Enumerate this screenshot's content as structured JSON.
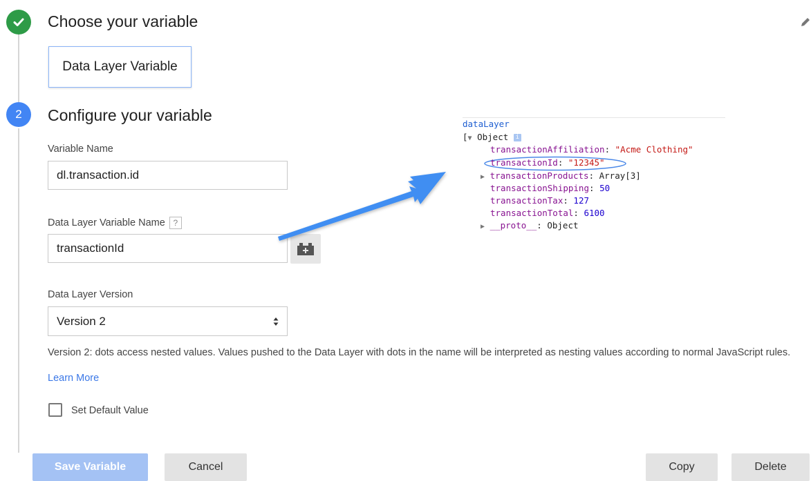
{
  "step1": {
    "title": "Choose your variable",
    "variable_type": "Data Layer Variable"
  },
  "step2": {
    "number": "2",
    "title": "Configure your variable"
  },
  "fields": {
    "variable_name": {
      "label": "Variable Name",
      "value": "dl.transaction.id"
    },
    "dl_variable_name": {
      "label": "Data Layer Variable Name",
      "help": "?",
      "value": "transactionId"
    },
    "dl_version": {
      "label": "Data Layer Version",
      "selected": "Version 2",
      "description": "Version 2: dots access nested values. Values pushed to the Data Layer with dots in the name will be interpreted as nesting values according to normal JavaScript rules.",
      "learn_more": "Learn More"
    },
    "default_value": {
      "label": "Set Default Value",
      "checked": false
    }
  },
  "buttons": {
    "save": "Save Variable",
    "cancel": "Cancel",
    "copy": "Copy",
    "delete": "Delete"
  },
  "console": {
    "title": "dataLayer",
    "object_label": "Object",
    "info": "i",
    "props": [
      {
        "key": "transactionAffiliation",
        "value": "\"Acme Clothing\"",
        "kind": "str"
      },
      {
        "key": "transactionId",
        "value": "\"12345\"",
        "kind": "str",
        "highlighted": true
      },
      {
        "key": "transactionProducts",
        "value": "Array[3]",
        "kind": "plain",
        "expandable": true
      },
      {
        "key": "transactionShipping",
        "value": "50",
        "kind": "num"
      },
      {
        "key": "transactionTax",
        "value": "127",
        "kind": "num"
      },
      {
        "key": "transactionTotal",
        "value": "6100",
        "kind": "num"
      },
      {
        "key": "__proto__",
        "value": "Object",
        "kind": "plain",
        "expandable": true
      }
    ]
  },
  "colors": {
    "success": "#2e9b47",
    "step_blue": "#4285f4",
    "arrow": "#3f8ef2",
    "link": "#3b78e7"
  }
}
